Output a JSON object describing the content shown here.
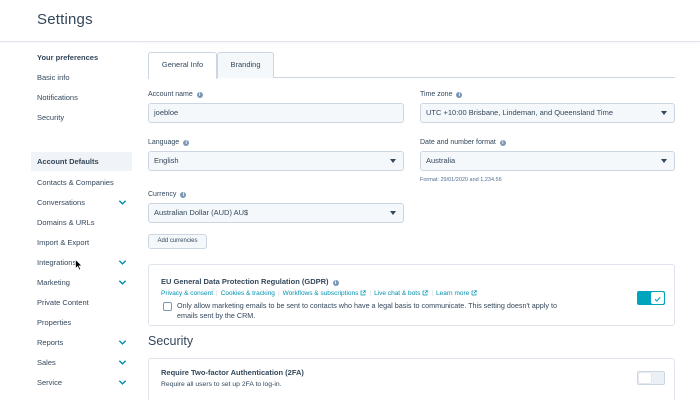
{
  "header": {
    "title": "Settings"
  },
  "sidebar": {
    "preferences_heading": "Your preferences",
    "preferences": [
      "Basic info",
      "Notifications",
      "Security"
    ],
    "account_heading": "Account Defaults",
    "items": [
      {
        "label": "Contacts & Companies",
        "expandable": false
      },
      {
        "label": "Conversations",
        "expandable": true
      },
      {
        "label": "Domains & URLs",
        "expandable": false
      },
      {
        "label": "Import & Export",
        "expandable": false
      },
      {
        "label": "Integrations",
        "expandable": true
      },
      {
        "label": "Marketing",
        "expandable": true
      },
      {
        "label": "Private Content",
        "expandable": false
      },
      {
        "label": "Properties",
        "expandable": false
      },
      {
        "label": "Reports",
        "expandable": true
      },
      {
        "label": "Sales",
        "expandable": true
      },
      {
        "label": "Service",
        "expandable": true
      }
    ]
  },
  "tabs": [
    "General Info",
    "Branding"
  ],
  "form": {
    "account_name_label": "Account name",
    "account_name_value": "joebloe",
    "time_zone_label": "Time zone",
    "time_zone_value": "UTC +10:00 Brisbane, Lindeman, and Queensland Time",
    "language_label": "Language",
    "language_value": "English",
    "date_format_label": "Date and number format",
    "date_format_value": "Australia",
    "date_format_helper": "Format: 29/01/2020 and 1,234.56",
    "currency_label": "Currency",
    "currency_value": "Australian Dollar (AUD) AU$",
    "add_currencies": "Add currencies"
  },
  "gdpr": {
    "title": "EU General Data Protection Regulation (GDPR)",
    "links": [
      "Privacy & consent",
      "Cookies & tracking",
      "Workflows & subscriptions",
      "Live chat & bots",
      "Learn more"
    ],
    "checkbox_text_line1": "Only allow marketing emails to be sent to contacts who have a legal basis to communicate. This setting doesn't apply to",
    "checkbox_text_line2": "emails sent by the CRM.",
    "enabled": true
  },
  "security": {
    "section_title": "Security",
    "twofa_title": "Require Two-factor Authentication (2FA)",
    "twofa_desc": "Require all users to set up 2FA to log-in.",
    "enabled": false
  },
  "colors": {
    "accent": "#00a4bd",
    "link": "#0091ae",
    "text": "#33475b",
    "border": "#cbd6e2",
    "field_bg": "#f5f8fa"
  },
  "icons": [
    "info-icon",
    "chevron-down-icon",
    "caret-down-icon",
    "external-link-icon",
    "check-icon",
    "mouse-cursor-icon"
  ]
}
